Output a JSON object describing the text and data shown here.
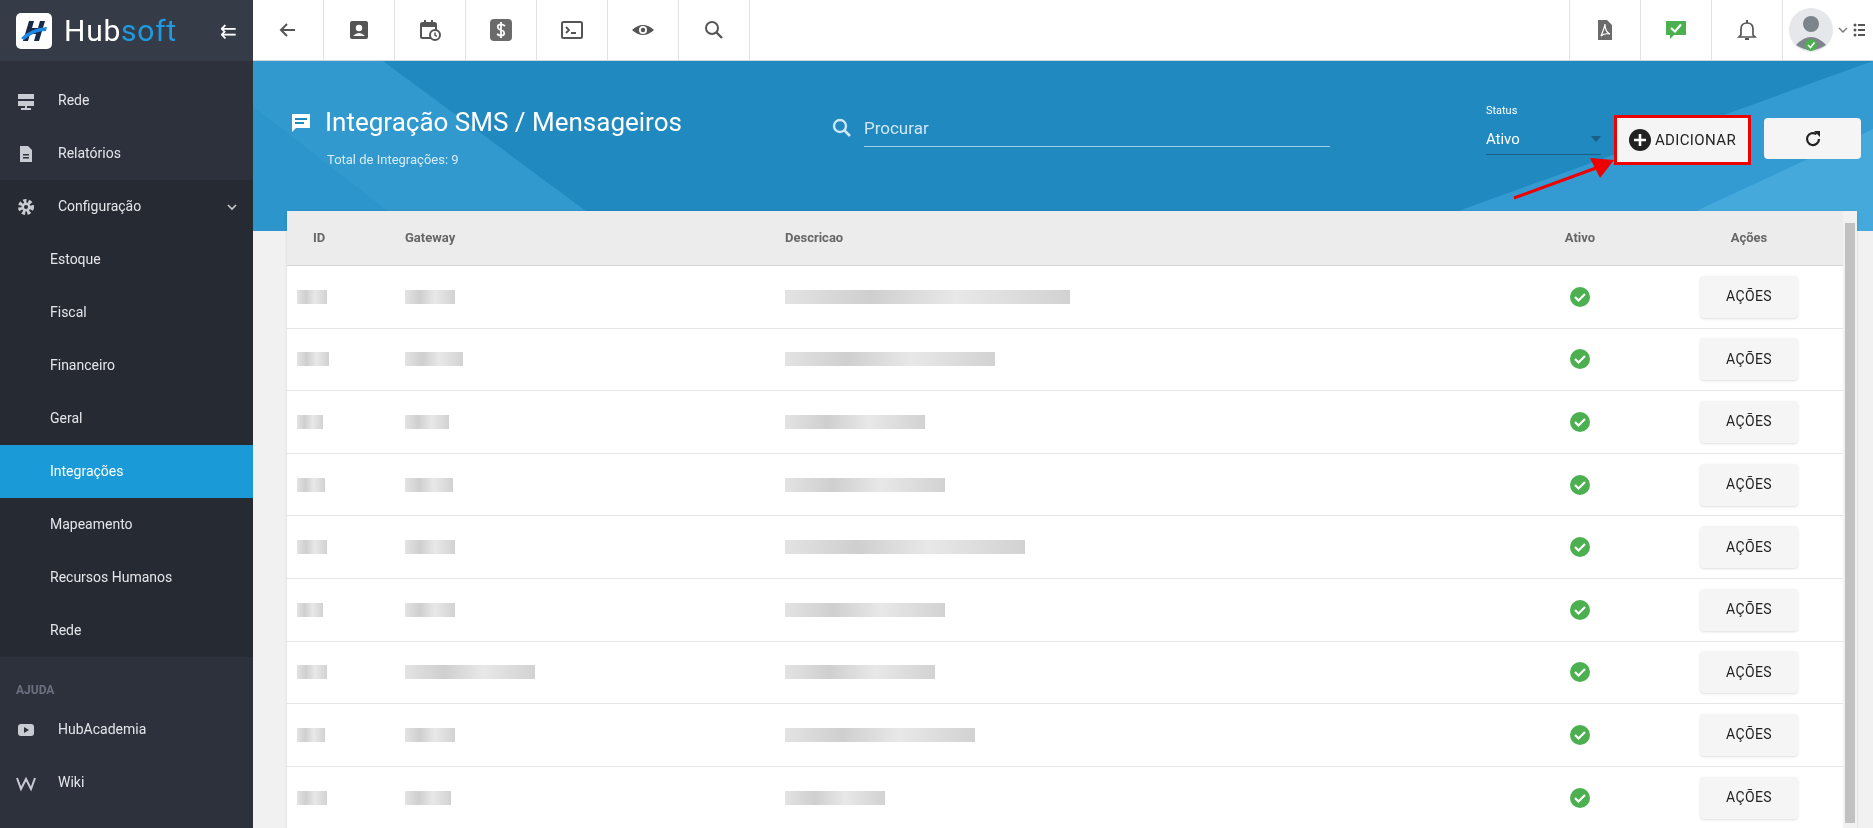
{
  "brand": {
    "name_first": "Hub",
    "name_second": "soft",
    "collapse_icon": "⇇"
  },
  "sidebar": {
    "items": [
      {
        "label": "Rede",
        "selected": false
      },
      {
        "label": "Relatórios",
        "selected": false
      },
      {
        "label": "Configuração",
        "selected": false,
        "expanded": true,
        "children": [
          {
            "label": "Estoque",
            "selected": false
          },
          {
            "label": "Fiscal",
            "selected": false
          },
          {
            "label": "Financeiro",
            "selected": false
          },
          {
            "label": "Geral",
            "selected": false
          },
          {
            "label": "Integrações",
            "selected": true
          },
          {
            "label": "Mapeamento",
            "selected": false
          },
          {
            "label": "Recursos Humanos",
            "selected": false
          },
          {
            "label": "Rede",
            "selected": false
          }
        ]
      }
    ],
    "section": "AJUDA",
    "help_items": [
      {
        "label": "HubAcademia"
      },
      {
        "label": "Wiki"
      }
    ]
  },
  "header": {
    "title": "Integração SMS / Mensageiros",
    "subtitle": "Total de Integrações: 9",
    "search": {
      "placeholder": "Procurar"
    },
    "status": {
      "label": "Status",
      "value": "Ativo"
    },
    "add_button": "ADICIONAR",
    "highlighted": true
  },
  "table": {
    "columns": [
      "ID",
      "Gateway",
      "Descricao",
      "Ativo",
      "Ações"
    ],
    "rows": [
      {
        "active": true,
        "action": "AÇÕES"
      },
      {
        "active": true,
        "action": "AÇÕES"
      },
      {
        "active": true,
        "action": "AÇÕES"
      },
      {
        "active": true,
        "action": "AÇÕES"
      },
      {
        "active": true,
        "action": "AÇÕES"
      },
      {
        "active": true,
        "action": "AÇÕES"
      },
      {
        "active": true,
        "action": "AÇÕES"
      },
      {
        "active": true,
        "action": "AÇÕES"
      },
      {
        "active": true,
        "action": "AÇÕES"
      }
    ]
  }
}
